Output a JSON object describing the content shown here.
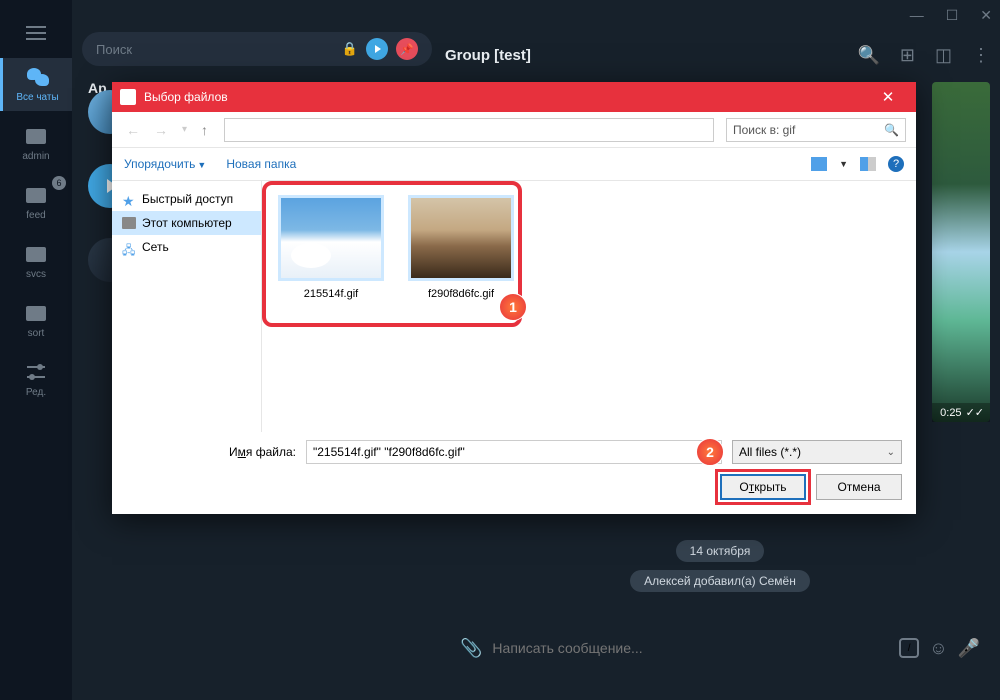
{
  "window": {
    "minimize": "—",
    "maximize": "☐",
    "close": "✕"
  },
  "sidebar": {
    "all_chats": "Все чаты",
    "admin": "admin",
    "feed": "feed",
    "feed_badge": "6",
    "svcs": "svcs",
    "sort": "sort",
    "edit": "Ред."
  },
  "search": {
    "placeholder": "Поиск"
  },
  "chat": {
    "title": "Group [test]",
    "section_heading": "Ap",
    "video_time": "0:25",
    "checks": "✓✓",
    "date_pill": "14 октября",
    "joined_pill": "Алексей добавил(а) Семён",
    "compose_placeholder": "Написать сообщение..."
  },
  "dialog": {
    "title": "Выбор файлов",
    "search_label": "Поиск в: gif",
    "organize": "Упорядочить",
    "new_folder": "Новая папка",
    "tree": {
      "quick": "Быстрый доступ",
      "pc": "Этот компьютер",
      "net": "Сеть"
    },
    "files": [
      {
        "name": "215514f.gif"
      },
      {
        "name": "f290f8d6fc.gif"
      }
    ],
    "callout1": "1",
    "callout2": "2",
    "filename_label_pre": "И",
    "filename_label_u": "м",
    "filename_label_post": "я файла:",
    "filename_value": "\"215514f.gif\" \"f290f8d6fc.gif\"",
    "filter": "All files (*.*)",
    "open_pre": "О",
    "open_u": "т",
    "open_post": "крыть",
    "cancel": "Отмена"
  }
}
